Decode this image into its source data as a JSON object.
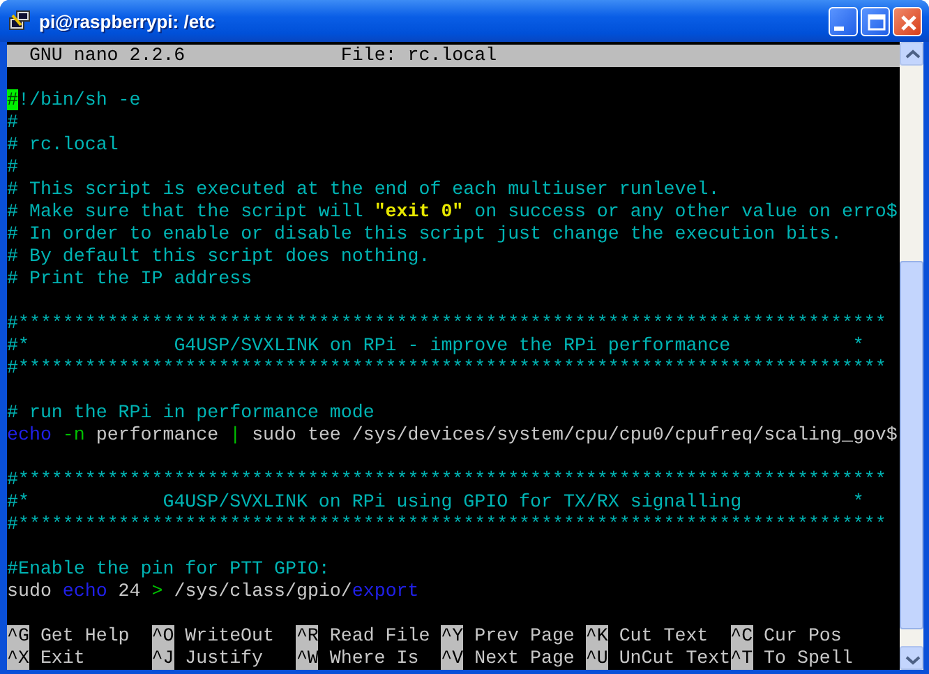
{
  "window": {
    "title": "pi@raspberrypi: /etc"
  },
  "header": {
    "program": "GNU nano 2.2.6",
    "file": "File: rc.local"
  },
  "lines": [
    {
      "kind": "blank"
    },
    {
      "kind": "code",
      "segments": [
        {
          "kind": "cursor",
          "text": "#"
        },
        {
          "kind": "comment",
          "text": "!/bin/sh -e"
        }
      ]
    },
    {
      "kind": "code",
      "segments": [
        {
          "kind": "comment",
          "text": "#"
        }
      ]
    },
    {
      "kind": "code",
      "segments": [
        {
          "kind": "comment",
          "text": "# rc.local"
        }
      ]
    },
    {
      "kind": "code",
      "segments": [
        {
          "kind": "comment",
          "text": "#"
        }
      ]
    },
    {
      "kind": "code",
      "segments": [
        {
          "kind": "comment",
          "text": "# This script is executed at the end of each multiuser runlevel."
        }
      ]
    },
    {
      "kind": "code",
      "segments": [
        {
          "kind": "comment",
          "text": "# Make sure that the script will "
        },
        {
          "kind": "string",
          "text": "\"exit 0\""
        },
        {
          "kind": "comment",
          "text": " on success or any other value on erro$"
        }
      ]
    },
    {
      "kind": "code",
      "segments": [
        {
          "kind": "comment",
          "text": "# In order to enable or disable this script just change the execution bits."
        }
      ]
    },
    {
      "kind": "code",
      "segments": [
        {
          "kind": "comment",
          "text": "# By default this script does nothing."
        }
      ]
    },
    {
      "kind": "code",
      "segments": [
        {
          "kind": "comment",
          "text": "# Print the IP address"
        }
      ]
    },
    {
      "kind": "blank"
    },
    {
      "kind": "code",
      "segments": [
        {
          "kind": "comment",
          "text": "#******************************************************************************"
        }
      ]
    },
    {
      "kind": "code",
      "segments": [
        {
          "kind": "comment",
          "text": "#*             G4USP/SVXLINK on RPi - improve the RPi performance           *"
        }
      ]
    },
    {
      "kind": "code",
      "segments": [
        {
          "kind": "comment",
          "text": "#******************************************************************************"
        }
      ]
    },
    {
      "kind": "blank"
    },
    {
      "kind": "code",
      "segments": [
        {
          "kind": "comment",
          "text": "# run the RPi in performance mode"
        }
      ]
    },
    {
      "kind": "code",
      "segments": [
        {
          "kind": "keyword",
          "text": "echo"
        },
        {
          "kind": "operator",
          "text": " -n"
        },
        {
          "kind": "plain",
          "text": " performance "
        },
        {
          "kind": "operator",
          "text": "|"
        },
        {
          "kind": "plain",
          "text": " sudo tee /sys/devices/system/cpu/cpu0/cpufreq/scaling_gov$"
        }
      ]
    },
    {
      "kind": "blank"
    },
    {
      "kind": "code",
      "segments": [
        {
          "kind": "comment",
          "text": "#******************************************************************************"
        }
      ]
    },
    {
      "kind": "code",
      "segments": [
        {
          "kind": "comment",
          "text": "#*            G4USP/SVXLINK on RPi using GPIO for TX/RX signalling          *"
        }
      ]
    },
    {
      "kind": "code",
      "segments": [
        {
          "kind": "comment",
          "text": "#******************************************************************************"
        }
      ]
    },
    {
      "kind": "blank"
    },
    {
      "kind": "code",
      "segments": [
        {
          "kind": "comment",
          "text": "#Enable the pin for PTT GPIO:"
        }
      ]
    },
    {
      "kind": "code",
      "segments": [
        {
          "kind": "plain",
          "text": "sudo "
        },
        {
          "kind": "keyword",
          "text": "echo"
        },
        {
          "kind": "plain",
          "text": " 24 "
        },
        {
          "kind": "operator",
          "text": ">"
        },
        {
          "kind": "plain",
          "text": " /sys/class/gpio/"
        },
        {
          "kind": "keyword",
          "text": "export"
        }
      ]
    },
    {
      "kind": "blank"
    }
  ],
  "shortcuts": [
    [
      {
        "key": "^G",
        "label": "Get Help"
      },
      {
        "key": "^O",
        "label": "WriteOut"
      },
      {
        "key": "^R",
        "label": "Read File"
      },
      {
        "key": "^Y",
        "label": "Prev Page"
      },
      {
        "key": "^K",
        "label": "Cut Text"
      },
      {
        "key": "^C",
        "label": "Cur Pos"
      }
    ],
    [
      {
        "key": "^X",
        "label": "Exit"
      },
      {
        "key": "^J",
        "label": "Justify"
      },
      {
        "key": "^W",
        "label": "Where Is"
      },
      {
        "key": "^V",
        "label": "Next Page"
      },
      {
        "key": "^U",
        "label": "UnCut Text"
      },
      {
        "key": "^T",
        "label": "To Spell"
      }
    ]
  ]
}
